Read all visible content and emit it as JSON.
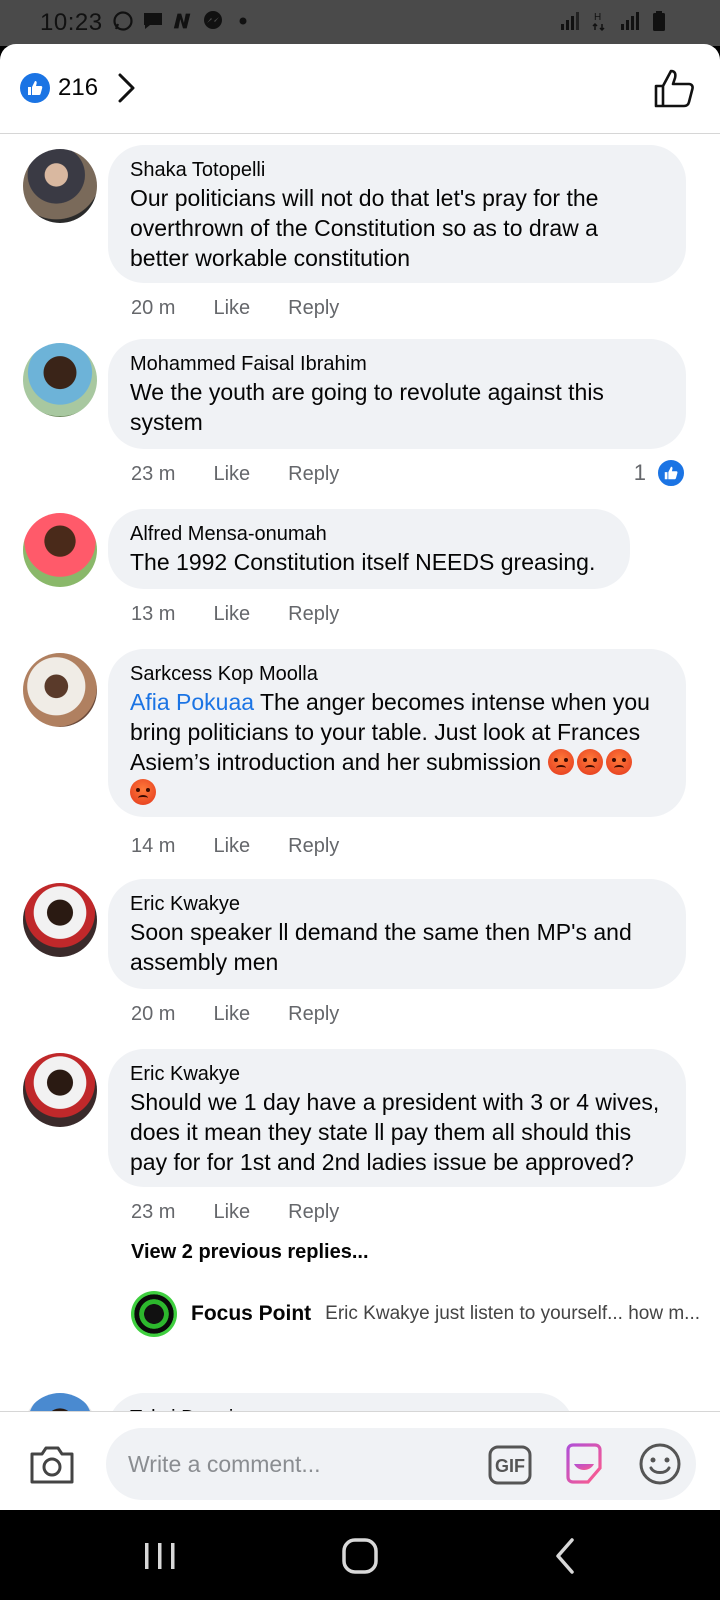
{
  "status_bar": {
    "time": "10:23",
    "left_icons": [
      "whatsapp-icon",
      "message-icon",
      "app-icon",
      "messenger-icon",
      "dot-icon"
    ],
    "right_icons": [
      "signal-icon",
      "data-icon",
      "signal-icon",
      "battery-icon"
    ]
  },
  "reactions": {
    "count": "216",
    "like_color": "#1b74e4"
  },
  "comments": [
    {
      "author": "Shaka Totopelli",
      "lines": [
        "Our politicians will not do that let's pray for the",
        "overthrown of the Constitution so as to draw  a",
        "better workable constitution"
      ],
      "time": "20 m",
      "like": "Like",
      "reply": "Reply"
    },
    {
      "author": "Mohammed Faisal Ibrahim",
      "lines": [
        "We the youth are going to revolute against this",
        "system"
      ],
      "time": "23 m",
      "like": "Like",
      "reply": "Reply",
      "like_count": "1"
    },
    {
      "author": "Alfred Mensa-onumah",
      "lines": [
        "The 1992 Constitution itself NEEDS greasing."
      ],
      "time": "13 m",
      "like": "Like",
      "reply": "Reply"
    },
    {
      "author": "Sarkcess Kop Moolla",
      "mention": "Afia Pokuaa",
      "line1_rest": " The anger becomes intense when you",
      "lines": [
        "bring politicians to your table. Just look at Frances",
        "Asiem’s  introduction and her submission "
      ],
      "emoji": "angry-face-icon",
      "time": "14 m",
      "like": "Like",
      "reply": "Reply"
    },
    {
      "author": "Eric Kwakye",
      "lines": [
        "Soon speaker ll demand the same then MP's and",
        "assembly men"
      ],
      "time": "20 m",
      "like": "Like",
      "reply": "Reply"
    },
    {
      "author": "Eric Kwakye",
      "lines": [
        "Should we 1 day have a president with 3 or 4 wives,",
        "does it mean they state ll pay them all should this",
        "pay for for 1st and 2nd ladies  issue be approved?"
      ],
      "time": "23 m",
      "like": "Like",
      "reply": "Reply",
      "view_replies": "View 2 previous replies...",
      "reply_preview": {
        "author": "Focus Point",
        "text": "Eric Kwakye just listen to yourself... how m..."
      }
    },
    {
      "author": "Takyi Dennis"
    }
  ],
  "composer": {
    "placeholder": "Write a comment..."
  }
}
